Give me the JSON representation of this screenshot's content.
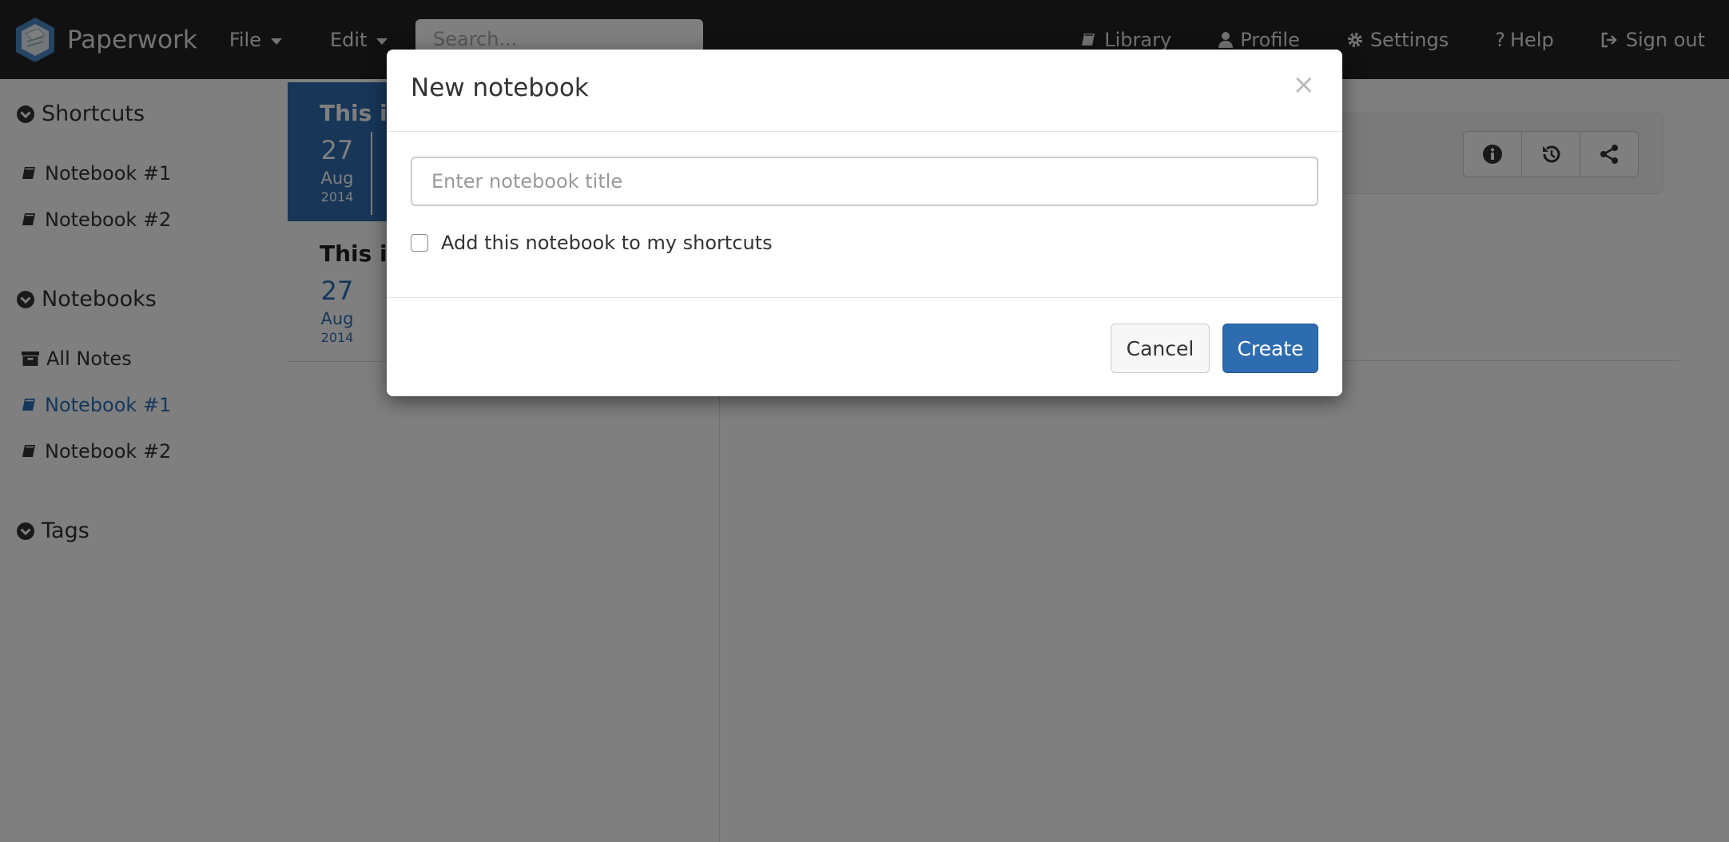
{
  "navbar": {
    "brand": "Paperwork",
    "menu": [
      {
        "label": "File",
        "icon": "caret-down-icon"
      },
      {
        "label": "Edit",
        "icon": "caret-down-icon"
      }
    ],
    "search_placeholder": "Search...",
    "links": [
      {
        "label": "Library",
        "icon": "book-icon"
      },
      {
        "label": "Profile",
        "icon": "user-icon"
      },
      {
        "label": "Settings",
        "icon": "gear-icon"
      },
      {
        "label": "Help",
        "icon": "question-icon"
      },
      {
        "label": "Sign out",
        "icon": "sign-out-icon"
      }
    ]
  },
  "sidebar": {
    "shortcuts_label": "Shortcuts",
    "shortcuts": [
      "Notebook #1",
      "Notebook #2"
    ],
    "notebooks_label": "Notebooks",
    "notebooks": [
      {
        "label": "All Notes",
        "icon": "archive-icon",
        "active": false
      },
      {
        "label": "Notebook #1",
        "icon": "book-icon",
        "active": true
      },
      {
        "label": "Notebook #2",
        "icon": "book-icon",
        "active": false
      }
    ],
    "tags_label": "Tags"
  },
  "notes": [
    {
      "title": "This is",
      "day": "27",
      "month": "Aug",
      "year": "2014",
      "selected": true
    },
    {
      "title": "This is",
      "day": "27",
      "month": "Aug",
      "year": "2014",
      "selected": false
    }
  ],
  "note_toolbar": [
    "info-icon",
    "history-icon",
    "share-icon"
  ],
  "modal": {
    "title": "New notebook",
    "close": "×",
    "input_placeholder": "Enter notebook title",
    "input_value": "",
    "checkbox_label": "Add this notebook to my shortcuts",
    "checkbox_checked": false,
    "cancel_label": "Cancel",
    "create_label": "Create"
  },
  "colors": {
    "navbar": "#222222",
    "accent": "#2e6cb0",
    "link_active": "#2a6eb7"
  }
}
